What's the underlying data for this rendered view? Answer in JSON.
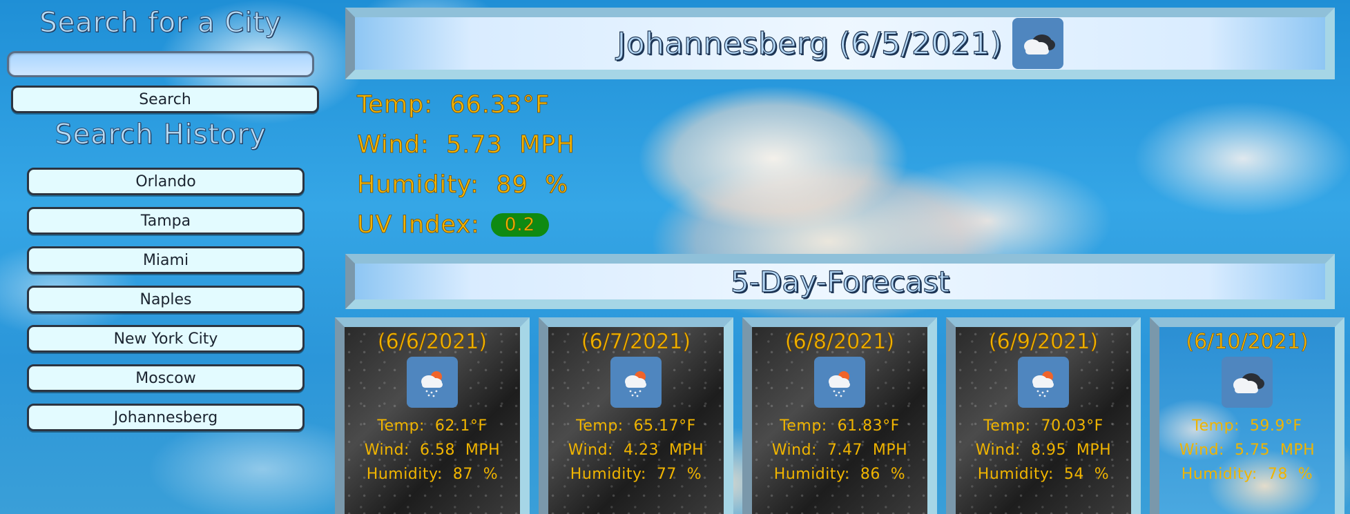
{
  "sidebar": {
    "search_title": "Search for a City",
    "search_placeholder": "",
    "search_button": "Search",
    "history_title": "Search History",
    "history": [
      "Orlando",
      "Tampa",
      "Miami",
      "Naples",
      "New York City",
      "Moscow",
      "Johannesberg"
    ]
  },
  "current": {
    "title": "Johannesberg (6/5/2021)",
    "icon": "cloudy-icon",
    "temp": "Temp:  66.33°F",
    "wind": "Wind:  5.73  MPH",
    "humidity": "Humidity:  89  %",
    "uv_label": "UV Index:",
    "uv_value": "0.2",
    "uv_color": "#0f8a12"
  },
  "forecast": {
    "title": "5-Day-Forecast",
    "days": [
      {
        "date": "(6/6/2021)",
        "icon": "rain-sun-icon",
        "temp": "Temp:  62.1°F",
        "wind": "Wind:  6.58  MPH",
        "humidity": "Humidity:  87  %"
      },
      {
        "date": "(6/7/2021)",
        "icon": "rain-sun-icon",
        "temp": "Temp:  65.17°F",
        "wind": "Wind:  4.23  MPH",
        "humidity": "Humidity:  77  %"
      },
      {
        "date": "(6/8/2021)",
        "icon": "rain-sun-icon",
        "temp": "Temp:  61.83°F",
        "wind": "Wind:  7.47  MPH",
        "humidity": "Humidity:  86  %"
      },
      {
        "date": "(6/9/2021)",
        "icon": "rain-sun-icon",
        "temp": "Temp:  70.03°F",
        "wind": "Wind:  8.95  MPH",
        "humidity": "Humidity:  54  %"
      },
      {
        "date": "(6/10/2021)",
        "icon": "cloudy-icon",
        "temp": "Temp:  59.9°F",
        "wind": "Wind:  5.75  MPH",
        "humidity": "Humidity:  78  %"
      }
    ]
  },
  "colors": {
    "accent_text": "#f0b400",
    "button_bg": "#e3fbff",
    "frame": "#a6d6e6",
    "icon_bg": "#4f86bf"
  }
}
